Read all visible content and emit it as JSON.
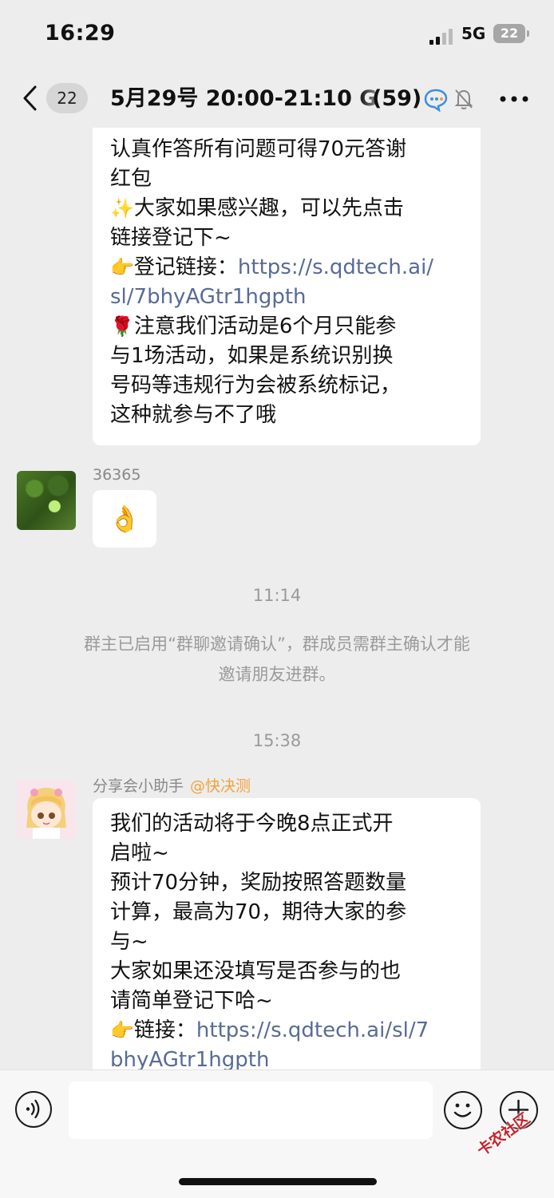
{
  "status_bar": {
    "time": "16:29",
    "network": "5G",
    "battery": "22"
  },
  "nav": {
    "unread_count": "22",
    "title": "5月29号 20:00-21:10 G",
    "member_count": "(59)",
    "icons": [
      "back-icon",
      "assistant-icon",
      "mute-icon",
      "more-icon"
    ]
  },
  "messages": {
    "m1": {
      "lines": {
        "l1": "认真作答所有问题可得70元答谢",
        "l2": "红包",
        "l3_emoji": "✨",
        "l3": "大家如果感兴趣，可以先点击",
        "l4": "链接登记下~",
        "l5_emoji": "👉",
        "l5": "登记链接：",
        "link_a": "https://s.qdtech.ai/",
        "link_b": "sl/7bhyAGtr1hgpth",
        "l7_emoji": "🌹",
        "l7": "注意我们活动是6个月只能参",
        "l8": "与1场活动，如果是系统识别换",
        "l9": "号码等违规行为会被系统标记，",
        "l10": "这种就参与不了哦"
      }
    },
    "m2": {
      "sender": "36365",
      "emoji": "👌"
    },
    "time1": "11:14",
    "system": {
      "line1": "群主已启用“群聊邀请确认”，群成员需群主确认才能",
      "line2": "邀请朋友进群。"
    },
    "time2": "15:38",
    "m3": {
      "sender": "分享会小助手",
      "mention": "@快决测",
      "lines": {
        "l1": "我们的活动将于今晚8点正式开",
        "l2": "启啦~",
        "l3": "预计70分钟，奖励按照答题数量",
        "l4": "计算，最高为70，期待大家的参",
        "l5": "与~",
        "l6": "大家如果还没填写是否参与的也",
        "l7": "请简单登记下哈~",
        "l8_emoji": "👉",
        "l8": "链接：",
        "link_a": "https://s.qdtech.ai/sl/7",
        "link_b": "bhyAGtr1hgpth"
      }
    }
  },
  "input": {
    "placeholder": ""
  },
  "watermark": "卡农社区",
  "colors": {
    "background": "#ededed",
    "bubble": "#ffffff",
    "link": "#576b95",
    "mention": "#f2a23a",
    "system_text": "#9a9a9a"
  }
}
